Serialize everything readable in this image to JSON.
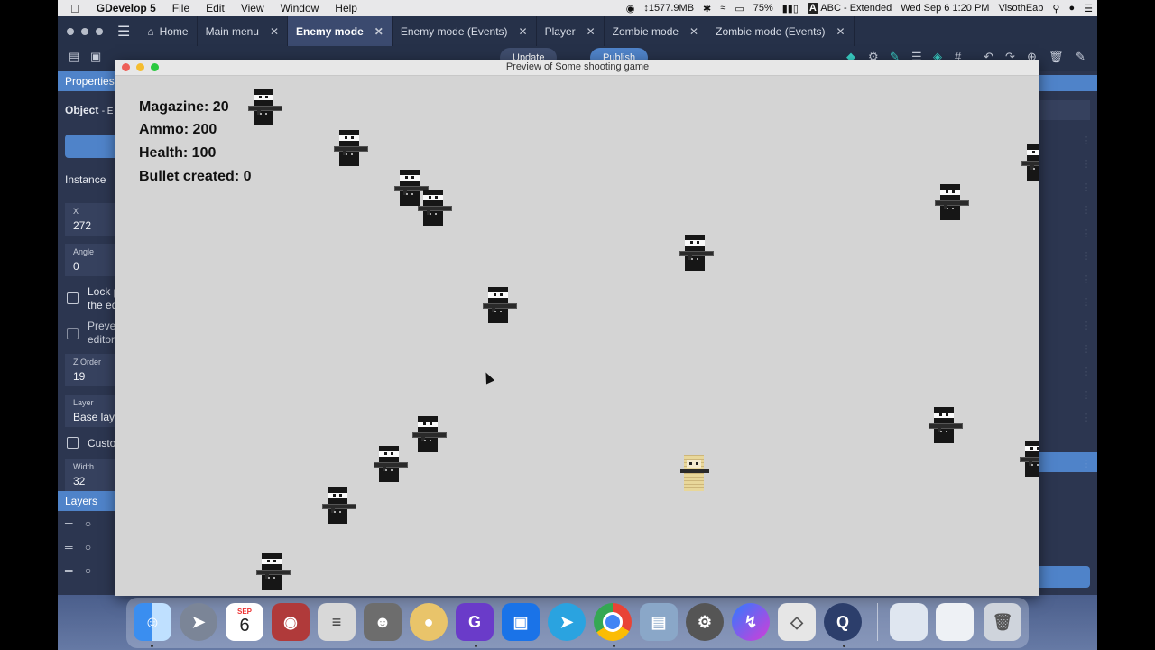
{
  "menubar": {
    "app_name": "GDevelop 5",
    "menus": [
      "File",
      "Edit",
      "View",
      "Window",
      "Help"
    ],
    "memory": "1577.9MB",
    "battery": "75%",
    "keyboard": "ABC - Extended",
    "datetime": "Wed Sep 6  1:20 PM",
    "user": "VisothEab"
  },
  "tabs": [
    {
      "label": "Home"
    },
    {
      "label": "Main menu"
    },
    {
      "label": "Enemy mode"
    },
    {
      "label": "Enemy mode (Events)"
    },
    {
      "label": "Player"
    },
    {
      "label": "Zombie mode"
    },
    {
      "label": "Zombie mode (Events)"
    }
  ],
  "toolbar": {
    "update_label": "Update",
    "publish_label": "Publish"
  },
  "properties": {
    "title": "Properties",
    "object_label": "Object",
    "object_name": "- E",
    "instance_label": "Instance",
    "x_label": "X",
    "x_value": "272",
    "angle_label": "Angle",
    "angle_value": "0",
    "lock_label_1": "Lock p",
    "lock_label_2": "the ed",
    "prevent_label_1": "Preven",
    "prevent_label_2": "editor",
    "zorder_label": "Z Order",
    "zorder_value": "19",
    "layer_label": "Layer",
    "layer_value": "Base lay",
    "custom_label": "Custom",
    "width_label": "Width",
    "width_value": "32",
    "layers_title": "Layers"
  },
  "preview": {
    "title": "Preview of Some shooting game",
    "hud": {
      "magazine": "Magazine: 20",
      "ammo": "Ammo: 200",
      "health": "Health: 100",
      "bullets": "Bullet created: 0"
    }
  },
  "dock": {
    "calendar_month": "SEP",
    "calendar_day": "6"
  }
}
